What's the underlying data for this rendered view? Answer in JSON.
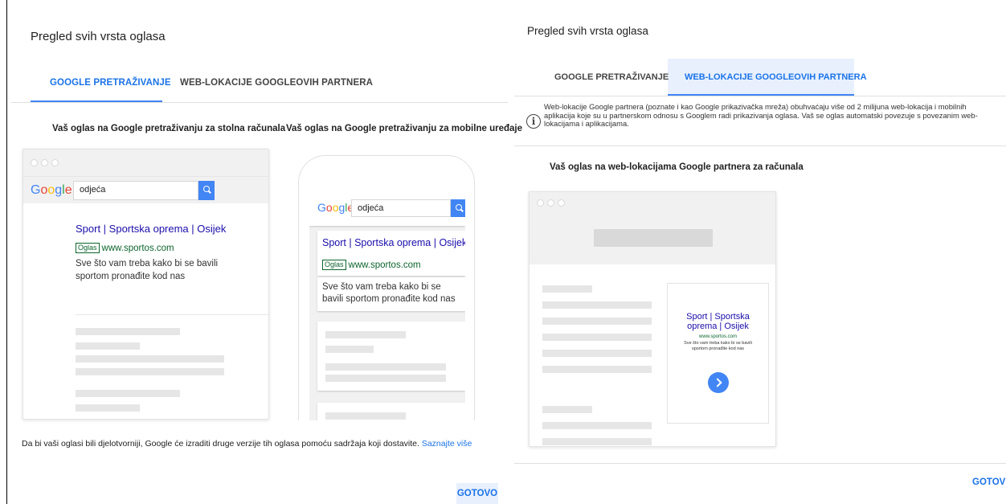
{
  "left_dialog": {
    "title": "Pregled svih vrsta oglasa",
    "tabs": [
      {
        "label": "GOOGLE PRETRAŽIVANJE",
        "active": true
      },
      {
        "label": "WEB-LOKACIJE GOOGLEOVIH PARTNERA",
        "active": false
      }
    ],
    "desktop_caption": "Vaš oglas na Google pretraživanju za stolna računala",
    "mobile_caption": "Vaš oglas na Google pretraživanju za mobilne uređaje",
    "google_logo": {
      "G": "G",
      "o1": "o",
      "o2": "o",
      "g": "g",
      "l": "l",
      "e": "e"
    },
    "search_query": "odjeća",
    "ad": {
      "title": "Sport | Sportska oprema | Osijek",
      "badge": "Oglas",
      "url": "www.sportos.com",
      "description": "Sve što vam treba kako bi se bavili sportom pronađite kod nas"
    },
    "footer_text": "Da bi vaši oglasi bili djelotvorniji, Google će izraditi druge verzije tih oglasa pomoću sadržaja koji dostavite.",
    "footer_link": "Saznajte više",
    "done_label": "GOTOVO"
  },
  "right_dialog": {
    "title": "Pregled svih vrsta oglasa",
    "tabs": [
      {
        "label": "GOOGLE PRETRAŽIVANJE",
        "active": false
      },
      {
        "label": "WEB-LOKACIJE GOOGLEOVIH PARTNERA",
        "active": true
      }
    ],
    "info_icon": "i",
    "info_text": "Web-lokacije Google partnera (poznate i kao Google prikazivačka mreža) obuhvaćaju više od 2 milijuna web-lokacija i mobilnih aplikacija koje su u partnerskom odnosu s Googlem radi prikazivanja oglasa. Vaš se oglas automatski povezuje s povezanim web-lokacijama i aplikacijama.",
    "caption": "Vaš oglas na web-lokacijama Google partnera za računala",
    "ad": {
      "title": "Sport | Sportska oprema | Osijek",
      "url": "www.sportos.com",
      "description": "Sve što vam treba kako bi se bavili sportom pronađite kod nas"
    },
    "done_label": "GOTOVO"
  },
  "colors": {
    "accent": "#1a73e8",
    "tab_indicator": "#4285f4",
    "ad_title": "#1a0dab",
    "ad_url": "#0d652d"
  }
}
